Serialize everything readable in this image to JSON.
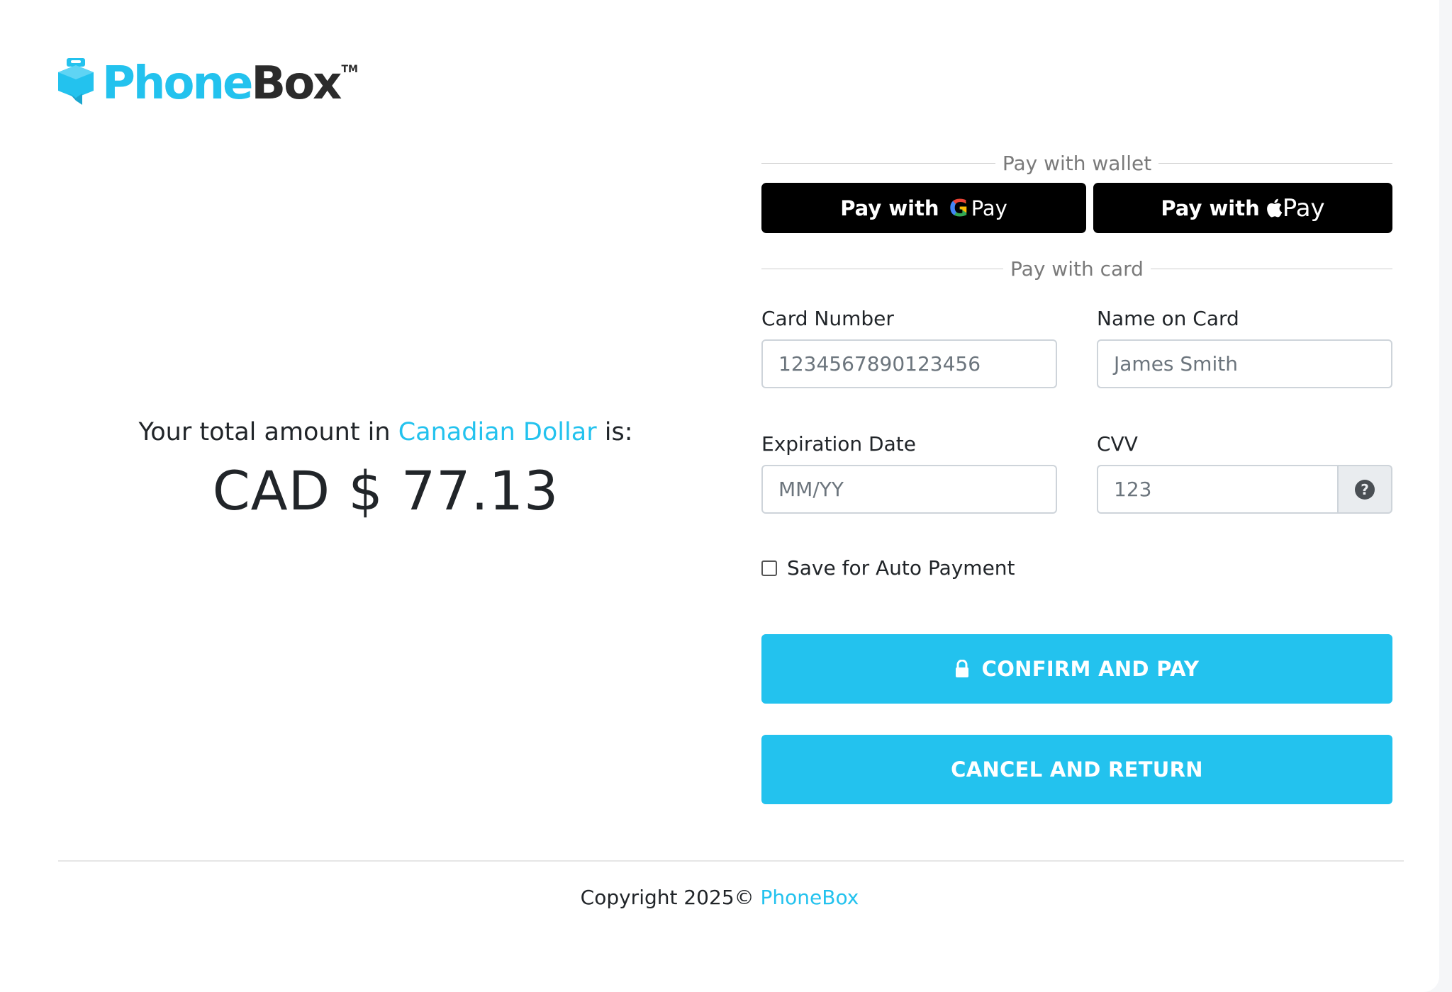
{
  "brand": {
    "name_part1": "Phone",
    "name_part2": "Box",
    "trademark": "TM",
    "accent_color": "#23c2ee"
  },
  "summary": {
    "label_prefix": "Your total amount in",
    "currency_name": "Canadian Dollar",
    "label_suffix": "is:",
    "amount": "CAD $ 77.13"
  },
  "wallet": {
    "divider": "Pay with wallet",
    "google_pay": {
      "prefix": "Pay with",
      "g": "G",
      "word": "Pay",
      "icon": "google-g-icon"
    },
    "apple_pay": {
      "prefix": "Pay with",
      "word": "Pay",
      "icon": "apple-logo-icon"
    }
  },
  "card": {
    "divider": "Pay with card",
    "card_number": {
      "label": "Card Number",
      "placeholder": "1234567890123456"
    },
    "name_on_card": {
      "label": "Name on Card",
      "placeholder": "James Smith"
    },
    "expiration": {
      "label": "Expiration Date",
      "placeholder": "MM/YY"
    },
    "cvv": {
      "label": "CVV",
      "placeholder": "123",
      "help_symbol": "?",
      "help_icon": "question-circle-icon"
    },
    "save_auto": {
      "label": "Save for Auto Payment",
      "checked": false
    }
  },
  "actions": {
    "confirm": {
      "label": "CONFIRM AND PAY",
      "icon": "lock-icon"
    },
    "cancel": {
      "label": "CANCEL AND RETURN"
    }
  },
  "footer": {
    "copyright": "Copyright 2025©",
    "link": "PhoneBox"
  }
}
